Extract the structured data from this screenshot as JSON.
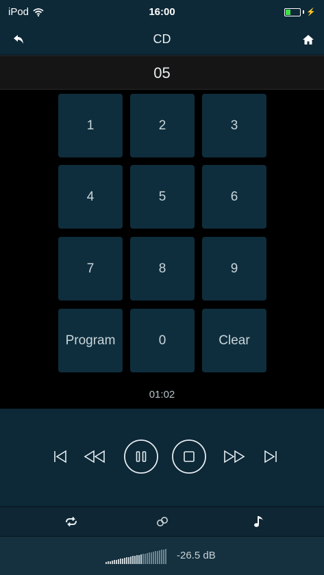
{
  "status_bar": {
    "carrier": "iPod",
    "time": "16:00",
    "battery_level": 0.35
  },
  "nav": {
    "title": "CD",
    "back_icon": "back-arrow-icon",
    "home_icon": "home-icon"
  },
  "display": {
    "track_number": "05"
  },
  "keypad": {
    "keys": [
      "1",
      "2",
      "3",
      "4",
      "5",
      "6",
      "7",
      "8",
      "9",
      "Program",
      "0",
      "Clear"
    ]
  },
  "time_readout": "01:02",
  "transport": {
    "buttons": [
      "skip-previous-icon",
      "rewind-icon",
      "pause-icon",
      "stop-icon",
      "fast-forward-icon",
      "skip-next-icon"
    ]
  },
  "mode_bar": {
    "buttons": [
      "repeat-icon",
      "link-icon",
      "music-note-icon"
    ]
  },
  "volume": {
    "level_text": "-26.5 dB",
    "level_fraction": 0.6
  },
  "colors": {
    "background": "#000000",
    "panel": "#0d2836",
    "key": "#0f2e3d",
    "battery": "#3fe04a"
  }
}
